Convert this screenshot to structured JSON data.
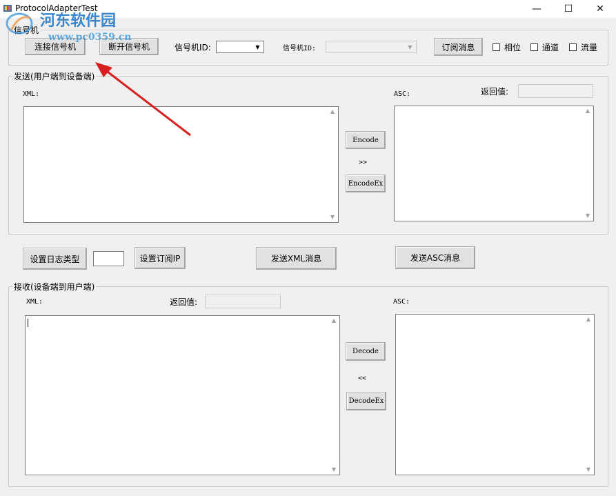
{
  "window": {
    "title": "ProtocolAdapterTest",
    "minimize": "—",
    "maximize": "☐",
    "close": "✕"
  },
  "watermark": {
    "brand": "河东软件园",
    "url": "www.pc0359.cn"
  },
  "signal_group": {
    "label": "信号机",
    "connect_button": "连接信号机",
    "disconnect_button": "断开信号机",
    "id_label_1": "信号机ID:",
    "id_label_2": "信号机ID:",
    "id_combo_1_value": "",
    "id_combo_2_value": "",
    "subscribe_button": "订阅消息",
    "checkboxes": [
      {
        "label": "相位",
        "checked": false
      },
      {
        "label": "通道",
        "checked": false
      },
      {
        "label": "流量",
        "checked": false
      }
    ]
  },
  "send_group": {
    "label": "发送(用户端到设备端)",
    "xml_label": "XML:",
    "asc_label": "ASC:",
    "return_label": "返回值:",
    "return_value": "",
    "encode_button": "Encode",
    "arrow": ">>",
    "encodeex_button": "EncodeEx"
  },
  "middle": {
    "log_type_button": "设置日志类型",
    "log_type_value": "",
    "subscribe_ip_button": "设置订阅IP",
    "send_xml_button": "发送XML消息",
    "send_asc_button": "发送ASC消息"
  },
  "receive_group": {
    "label": "接收(设备端到用户端)",
    "xml_label": "XML:",
    "return_label": "返回值:",
    "return_value": "",
    "asc_label": "ASC:",
    "decode_button": "Decode",
    "arrow": "<<",
    "decodeex_button": "DecodeEx"
  },
  "colors": {
    "annotation_arrow": "#d81e1e",
    "watermark": "#1a73c9"
  }
}
